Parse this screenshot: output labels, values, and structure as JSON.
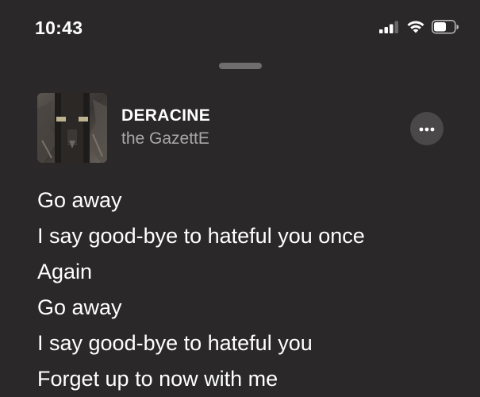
{
  "status_bar": {
    "time": "10:43",
    "icons": [
      "cellular-signal-icon",
      "wifi-icon",
      "battery-icon"
    ]
  },
  "track": {
    "title": "DERACINE",
    "artist": "the GazettE",
    "artwork": "album-artwork",
    "more_icon": "ellipsis-icon"
  },
  "lyrics": [
    "Go away",
    "I say good-bye to hateful you once",
    "Again",
    "Go away",
    "I say good-bye to hateful you",
    "Forget up to now with me"
  ],
  "colors": {
    "background": "#2a2829",
    "text_primary": "#ffffff",
    "text_secondary": "#a9a7a8",
    "button_bg": "#4a4849"
  }
}
